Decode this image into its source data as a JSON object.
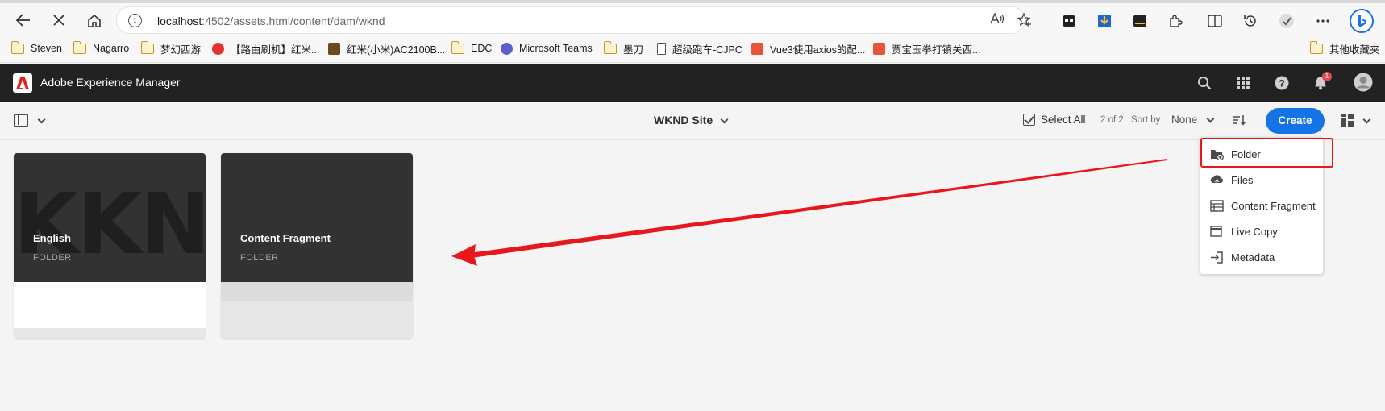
{
  "browser": {
    "url_host": "localhost",
    "url_rest": ":4502/assets.html/content/dam/wknd"
  },
  "bookmarks": [
    {
      "label": "Steven",
      "icon": "folder-icon"
    },
    {
      "label": "Nagarro",
      "icon": "folder-icon"
    },
    {
      "label": "梦幻西游",
      "icon": "folder-icon"
    },
    {
      "label": "【路由刷机】红米...",
      "icon": "site-icon"
    },
    {
      "label": "红米(小米)AC2100B...",
      "icon": "site-icon"
    },
    {
      "label": "EDC",
      "icon": "folder-icon"
    },
    {
      "label": "Microsoft Teams",
      "icon": "teams-icon"
    },
    {
      "label": "墨刀",
      "icon": "folder-icon"
    },
    {
      "label": "超级跑车-CJPC",
      "icon": "page-icon"
    },
    {
      "label": "Vue3使用axios的配...",
      "icon": "site-icon"
    },
    {
      "label": "贾宝玉拳打镇关西...",
      "icon": "site-icon"
    },
    {
      "label": "其他收藏夹",
      "icon": "folder-icon"
    }
  ],
  "header": {
    "app_title": "Adobe Experience Manager",
    "notification_count": "1"
  },
  "action_bar": {
    "site_title": "WKND Site",
    "select_all": "Select All",
    "count": "2 of 2",
    "sort_by_label": "Sort by",
    "sort_value": "None",
    "create_label": "Create"
  },
  "cards": [
    {
      "title": "English",
      "type": "FOLDER",
      "watermark": "KKN"
    },
    {
      "title": "Content Fragment",
      "type": "FOLDER"
    }
  ],
  "create_menu": {
    "items": [
      {
        "label": "Folder",
        "icon": "folder-add-icon"
      },
      {
        "label": "Files",
        "icon": "upload-cloud-icon"
      },
      {
        "label": "Content Fragment",
        "icon": "content-fragment-icon"
      },
      {
        "label": "Live Copy",
        "icon": "live-copy-icon"
      },
      {
        "label": "Metadata",
        "icon": "metadata-import-icon"
      }
    ]
  },
  "colors": {
    "accent_blue": "#1473e6",
    "header_dark": "#222222",
    "annotation_red": "#e8171e"
  }
}
